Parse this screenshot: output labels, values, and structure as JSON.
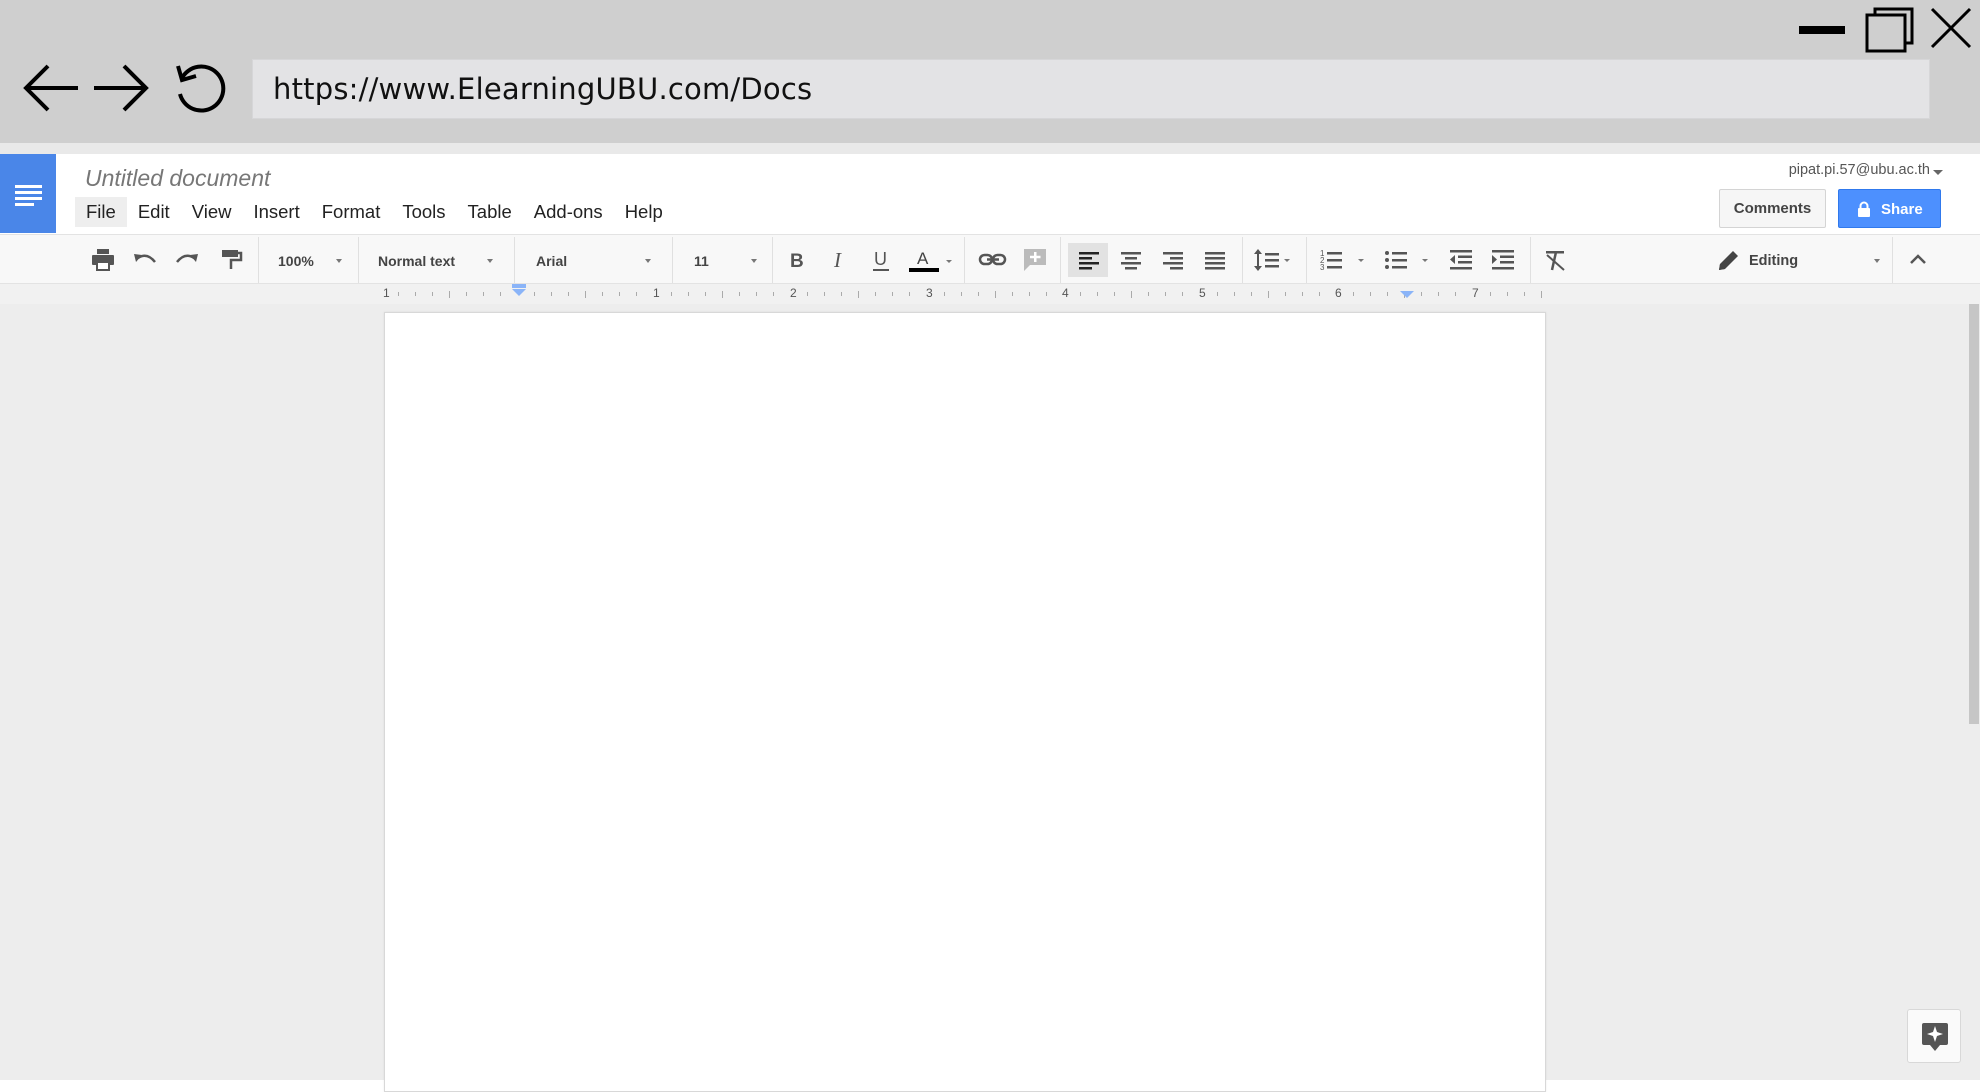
{
  "browser": {
    "url": "https://www.ElearningUBU.com/Docs",
    "window_controls": {
      "minimize": "minimize-icon",
      "maximize": "maximize-icon",
      "close": "close-icon"
    },
    "nav_icons": [
      "back-arrow-icon",
      "forward-arrow-icon",
      "reload-icon"
    ]
  },
  "docs": {
    "title": "Untitled document",
    "account": "pipat.pi.57@ubu.ac.th",
    "menu": [
      "File",
      "Edit",
      "View",
      "Insert",
      "Format",
      "Tools",
      "Table",
      "Add-ons",
      "Help"
    ],
    "active_menu": "File",
    "comments_label": "Comments",
    "share_label": "Share"
  },
  "toolbar": {
    "zoom": "100%",
    "style": "Normal text",
    "font": "Arial",
    "font_size": "11",
    "mode": "Editing",
    "active_alignment": "left"
  },
  "ruler": {
    "labels": [
      "1",
      "1",
      "2",
      "3",
      "4",
      "5",
      "6",
      "7"
    ]
  },
  "colors": {
    "chrome": "#cfcfcf",
    "docs_blue": "#4a86e8",
    "share_blue": "#4d90fe",
    "canvas": "#ededed",
    "indent_marker": "#8ab4f8"
  }
}
